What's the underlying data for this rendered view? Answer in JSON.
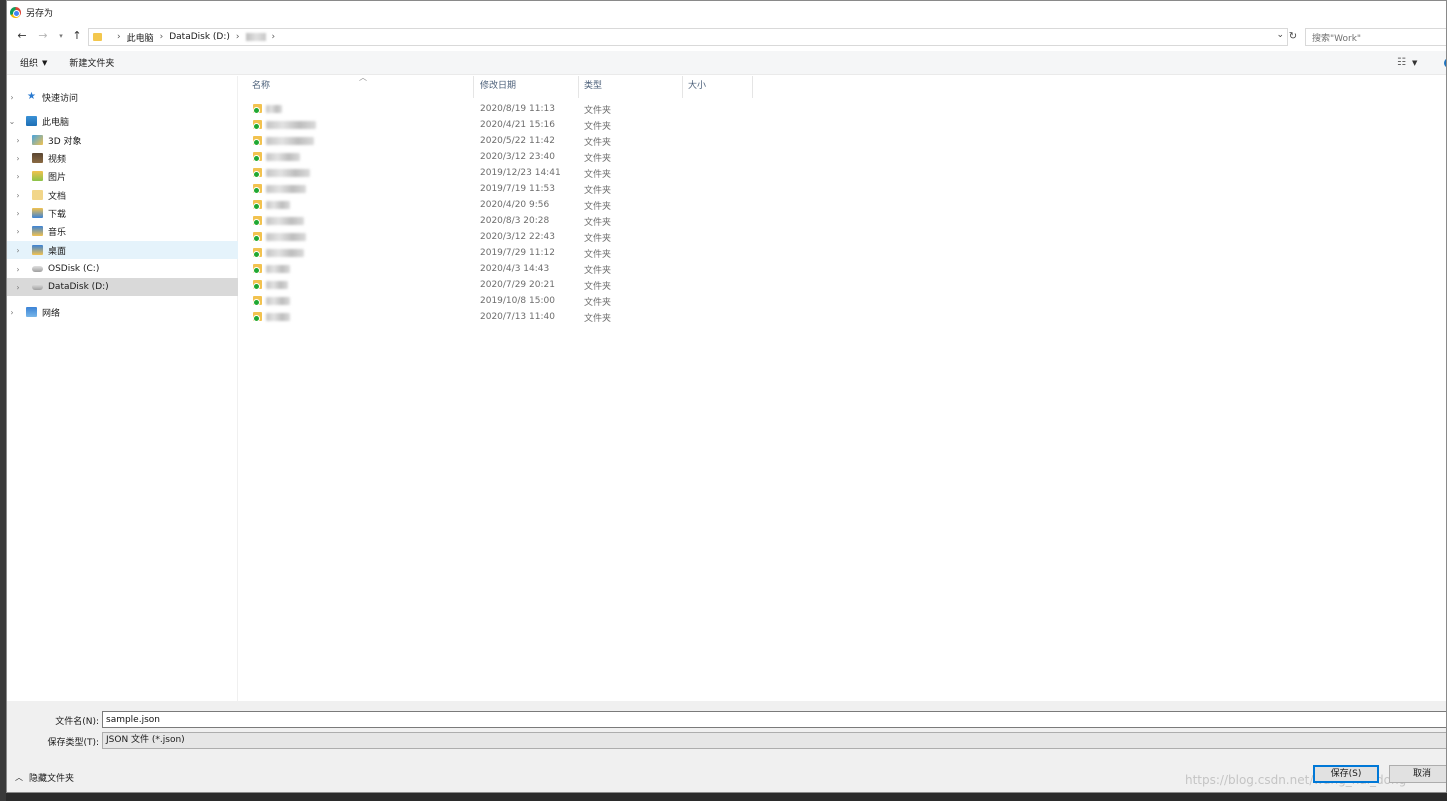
{
  "window": {
    "title": "另存为"
  },
  "address": {
    "crumbs": [
      "此电脑",
      "DataDisk (D:)"
    ],
    "search_placeholder": "搜索\"Work\""
  },
  "toolbar": {
    "organize": "组织",
    "new_folder": "新建文件夹"
  },
  "sidebar": {
    "items": [
      {
        "label": "快速访问"
      },
      {
        "label": "此电脑"
      },
      {
        "label": "3D 对象"
      },
      {
        "label": "视频"
      },
      {
        "label": "图片"
      },
      {
        "label": "文档"
      },
      {
        "label": "下载"
      },
      {
        "label": "音乐"
      },
      {
        "label": "桌面"
      },
      {
        "label": "OSDisk (C:)"
      },
      {
        "label": "DataDisk (D:)"
      },
      {
        "label": "网络"
      }
    ]
  },
  "columns": {
    "name": "名称",
    "date": "修改日期",
    "type": "类型",
    "size": "大小"
  },
  "files": [
    {
      "date": "2020/8/19 11:13",
      "type": "文件夹"
    },
    {
      "date": "2020/4/21 15:16",
      "type": "文件夹"
    },
    {
      "date": "2020/5/22 11:42",
      "type": "文件夹"
    },
    {
      "date": "2020/3/12 23:40",
      "type": "文件夹"
    },
    {
      "date": "2019/12/23 14:41",
      "type": "文件夹"
    },
    {
      "date": "2019/7/19 11:53",
      "type": "文件夹"
    },
    {
      "date": "2020/4/20 9:56",
      "type": "文件夹"
    },
    {
      "date": "2020/8/3 20:28",
      "type": "文件夹"
    },
    {
      "date": "2020/3/12 22:43",
      "type": "文件夹"
    },
    {
      "date": "2019/7/29 11:12",
      "type": "文件夹"
    },
    {
      "date": "2020/4/3 14:43",
      "type": "文件夹"
    },
    {
      "date": "2020/7/29 20:21",
      "type": "文件夹"
    },
    {
      "date": "2019/10/8 15:00",
      "type": "文件夹"
    },
    {
      "date": "2020/7/13 11:40",
      "type": "文件夹"
    }
  ],
  "form": {
    "filename_label": "文件名(N):",
    "filename_value": "sample.json",
    "filetype_label": "保存类型(T):",
    "filetype_value": "JSON 文件 (*.json)"
  },
  "footer": {
    "hide_folders": "隐藏文件夹",
    "save": "保存(S)",
    "cancel": "取消",
    "watermark": "https://blog.csdn.net/wang_hai_dong"
  }
}
